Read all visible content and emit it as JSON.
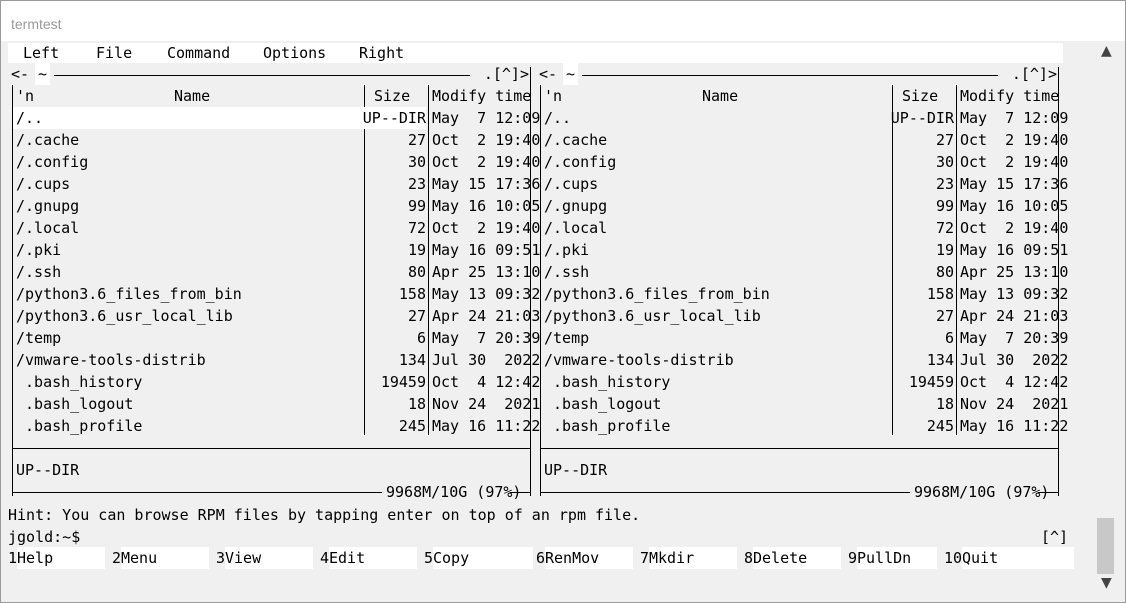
{
  "window": {
    "title": "termtest"
  },
  "menu": [
    "Left",
    "File",
    "Command",
    "Options",
    "Right"
  ],
  "panels": [
    {
      "path": "~",
      "corner": ".[^]>",
      "corner_left": "<-",
      "headers": {
        "n": "'n",
        "name": "Name",
        "size": "Size",
        "time": "Modify time"
      },
      "info": "UP--DIR",
      "disk": "9968M/10G (97%)"
    },
    {
      "path": "~",
      "corner": ".[^]>",
      "corner_left": "<-",
      "headers": {
        "n": "'n",
        "name": "Name",
        "size": "Size",
        "time": "Modify time"
      },
      "info": "UP--DIR",
      "disk": "9968M/10G (97%)"
    }
  ],
  "files": [
    {
      "name": "/..",
      "size": "UP--DIR",
      "time": "May  7 12:09"
    },
    {
      "name": "/.cache",
      "size": "27",
      "time": "Oct  2 19:40"
    },
    {
      "name": "/.config",
      "size": "30",
      "time": "Oct  2 19:40"
    },
    {
      "name": "/.cups",
      "size": "23",
      "time": "May 15 17:36"
    },
    {
      "name": "/.gnupg",
      "size": "99",
      "time": "May 16 10:05"
    },
    {
      "name": "/.local",
      "size": "72",
      "time": "Oct  2 19:40"
    },
    {
      "name": "/.pki",
      "size": "19",
      "time": "May 16 09:51"
    },
    {
      "name": "/.ssh",
      "size": "80",
      "time": "Apr 25 13:10"
    },
    {
      "name": "/python3.6_files_from_bin",
      "size": "158",
      "time": "May 13 09:32"
    },
    {
      "name": "/python3.6_usr_local_lib",
      "size": "27",
      "time": "Apr 24 21:03"
    },
    {
      "name": "/temp",
      "size": "6",
      "time": "May  7 20:39"
    },
    {
      "name": "/vmware-tools-distrib",
      "size": "134",
      "time": "Jul 30  2022"
    },
    {
      "name": " .bash_history",
      "size": "19459",
      "time": "Oct  4 12:42"
    },
    {
      "name": " .bash_logout",
      "size": "18",
      "time": "Nov 24  2021"
    },
    {
      "name": " .bash_profile",
      "size": "245",
      "time": "May 16 11:22"
    }
  ],
  "hint": "Hint: You can browse RPM files by tapping enter on top of an rpm file.",
  "prompt": "jgold:~$",
  "prompt_right": "[^]",
  "fkeys": [
    {
      "num": "1",
      "label": "Help"
    },
    {
      "num": "2",
      "label": "Menu"
    },
    {
      "num": "3",
      "label": "View"
    },
    {
      "num": "4",
      "label": "Edit"
    },
    {
      "num": "5",
      "label": "Copy"
    },
    {
      "num": "6",
      "label": "RenMov"
    },
    {
      "num": "7",
      "label": "Mkdir"
    },
    {
      "num": "8",
      "label": "Delete"
    },
    {
      "num": "9",
      "label": "PullDn"
    },
    {
      "num": "10",
      "label": "Quit"
    }
  ],
  "scroll": {
    "up_icon": "▲",
    "down_icon": "▼"
  }
}
